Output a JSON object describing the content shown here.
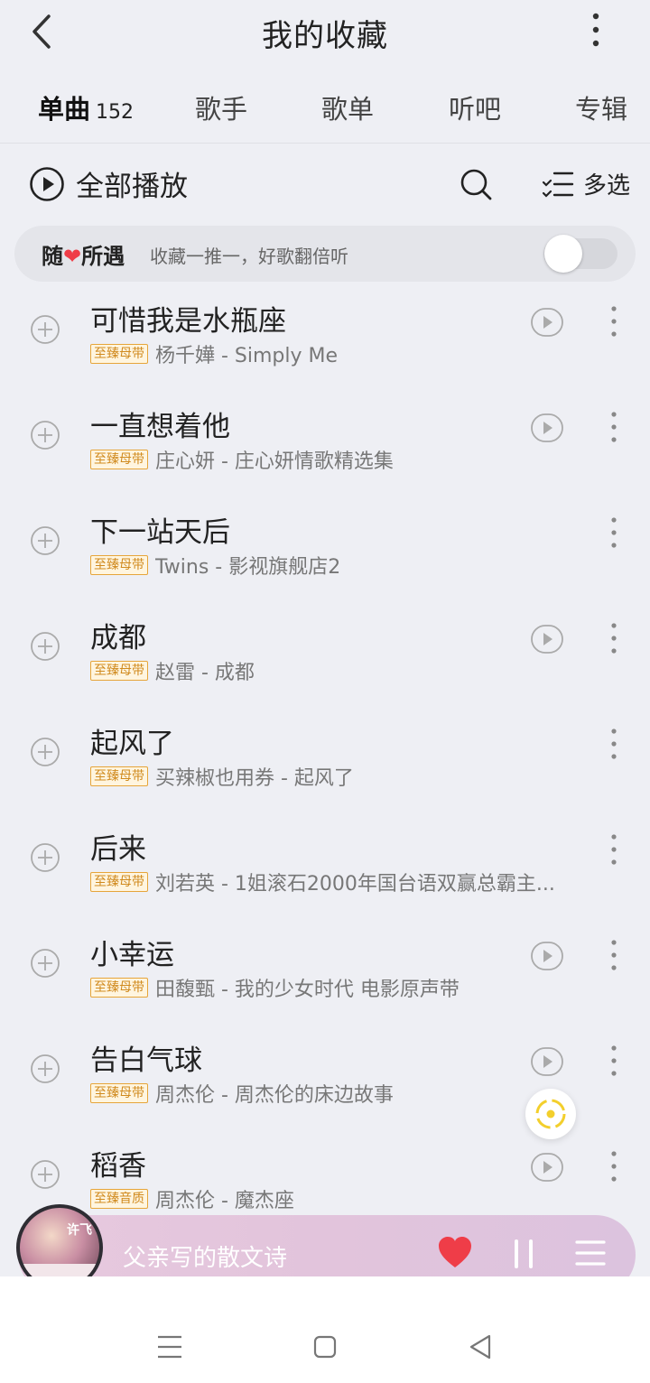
{
  "header": {
    "title": "我的收藏"
  },
  "tabs": [
    {
      "label": "单曲",
      "count": "152"
    },
    {
      "label": "歌手"
    },
    {
      "label": "歌单"
    },
    {
      "label": "听吧"
    },
    {
      "label": "专辑"
    }
  ],
  "actions": {
    "play_all": "全部播放",
    "multi_select": "多选"
  },
  "recommend": {
    "title_pre": "随",
    "title_post": "所遇",
    "subtitle": "收藏一推一，好歌翻倍听",
    "toggle_on": false
  },
  "songs": [
    {
      "title": "可惜我是水瓶座",
      "badge": "至臻母带",
      "subtitle": "杨千嬅 - Simply Me",
      "has_mv": true
    },
    {
      "title": "一直想着他",
      "badge": "至臻母带",
      "subtitle": "庄心妍 - 庄心妍情歌精选集",
      "has_mv": true
    },
    {
      "title": "下一站天后",
      "badge": "至臻母带",
      "subtitle": "Twins - 影视旗舰店2",
      "has_mv": false
    },
    {
      "title": "成都",
      "badge": "至臻母带",
      "subtitle": "赵雷 - 成都",
      "has_mv": true
    },
    {
      "title": "起风了",
      "badge": "至臻母带",
      "subtitle": "买辣椒也用券 - 起风了",
      "has_mv": false
    },
    {
      "title": "后来",
      "badge": "至臻母带",
      "subtitle": "刘若英 - 1姐滚石2000年国台语双赢总霸主...",
      "has_mv": false
    },
    {
      "title": "小幸运",
      "badge": "至臻母带",
      "subtitle": "田馥甄 - 我的少女时代 电影原声带",
      "has_mv": true
    },
    {
      "title": "告白气球",
      "badge": "至臻母带",
      "subtitle": "周杰伦 - 周杰伦的床边故事",
      "has_mv": true
    },
    {
      "title": "稻香",
      "badge": "至臻音质",
      "subtitle": "周杰伦 - 魔杰座",
      "has_mv": true
    }
  ],
  "player": {
    "now_playing": "父亲写的散文诗",
    "album_text": "许飞",
    "liked": true
  },
  "colors": {
    "accent_yellow": "#ffe14d",
    "heart_red": "#ef3d48",
    "badge_gold": "#e6a53a"
  },
  "icons": [
    "back-icon",
    "more-vertical-icon",
    "play-circle-icon",
    "search-icon",
    "multi-select-icon",
    "add-circle-icon",
    "mv-play-icon",
    "locate-icon",
    "heart-icon",
    "pause-icon",
    "playlist-icon",
    "menu-nav-icon",
    "home-nav-icon",
    "back-nav-icon"
  ]
}
